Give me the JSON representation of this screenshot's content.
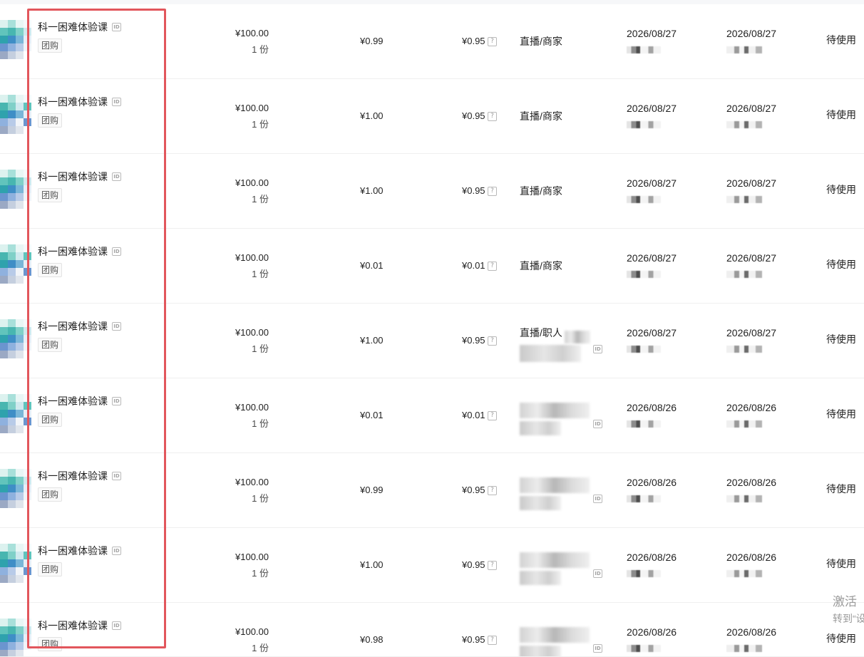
{
  "icons": {
    "id_icon": "id-icon",
    "id_icon_text": "ID",
    "help_icon": "question-icon",
    "help_icon_text": "?"
  },
  "colors": {
    "highlight_border": "#e2565c",
    "text_primary": "#1f1f1f"
  },
  "table": {
    "rows": [
      {
        "product_name": "科一困难体验课",
        "tag": "团购",
        "unit_price": "¥100.00",
        "quantity": "1 份",
        "paid_amount": "¥0.99",
        "income_amount": "¥0.95",
        "channel": "直播/商家",
        "channel_masked": false,
        "date_1": "2026/08/27",
        "date_2": "2026/08/27",
        "status": "待使用"
      },
      {
        "product_name": "科一困难体验课",
        "tag": "团购",
        "unit_price": "¥100.00",
        "quantity": "1 份",
        "paid_amount": "¥1.00",
        "income_amount": "¥0.95",
        "channel": "直播/商家",
        "channel_masked": false,
        "date_1": "2026/08/27",
        "date_2": "2026/08/27",
        "status": "待使用"
      },
      {
        "product_name": "科一困难体验课",
        "tag": "团购",
        "unit_price": "¥100.00",
        "quantity": "1 份",
        "paid_amount": "¥1.00",
        "income_amount": "¥0.95",
        "channel": "直播/商家",
        "channel_masked": false,
        "date_1": "2026/08/27",
        "date_2": "2026/08/27",
        "status": "待使用"
      },
      {
        "product_name": "科一困难体验课",
        "tag": "团购",
        "unit_price": "¥100.00",
        "quantity": "1 份",
        "paid_amount": "¥0.01",
        "income_amount": "¥0.01",
        "channel": "直播/商家",
        "channel_masked": false,
        "date_1": "2026/08/27",
        "date_2": "2026/08/27",
        "status": "待使用"
      },
      {
        "product_name": "科一困难体验课",
        "tag": "团购",
        "unit_price": "¥100.00",
        "quantity": "1 份",
        "paid_amount": "¥1.00",
        "income_amount": "¥0.95",
        "channel": "直播/职人",
        "channel_masked": true,
        "date_1": "2026/08/27",
        "date_2": "2026/08/27",
        "status": "待使用"
      },
      {
        "product_name": "科一困难体验课",
        "tag": "团购",
        "unit_price": "¥100.00",
        "quantity": "1 份",
        "paid_amount": "¥0.01",
        "income_amount": "¥0.01",
        "channel_masked": true,
        "date_1": "2026/08/26",
        "date_2": "2026/08/26",
        "status": "待使用"
      },
      {
        "product_name": "科一困难体验课",
        "tag": "团购",
        "unit_price": "¥100.00",
        "quantity": "1 份",
        "paid_amount": "¥0.99",
        "income_amount": "¥0.95",
        "channel_masked": true,
        "date_1": "2026/08/26",
        "date_2": "2026/08/26",
        "status": "待使用"
      },
      {
        "product_name": "科一困难体验课",
        "tag": "团购",
        "unit_price": "¥100.00",
        "quantity": "1 份",
        "paid_amount": "¥1.00",
        "income_amount": "¥0.95",
        "channel_masked": true,
        "date_1": "2026/08/26",
        "date_2": "2026/08/26",
        "status": "待使用"
      },
      {
        "product_name": "科一困难体验课",
        "tag": "团购",
        "unit_price": "¥100.00",
        "quantity": "1 份",
        "paid_amount": "¥0.98",
        "income_amount": "¥0.95",
        "channel_masked": true,
        "date_1": "2026/08/26",
        "date_2": "2026/08/26",
        "status": "待使用"
      }
    ]
  },
  "system_overlay": {
    "title": "激活",
    "hint": "转到“设"
  }
}
